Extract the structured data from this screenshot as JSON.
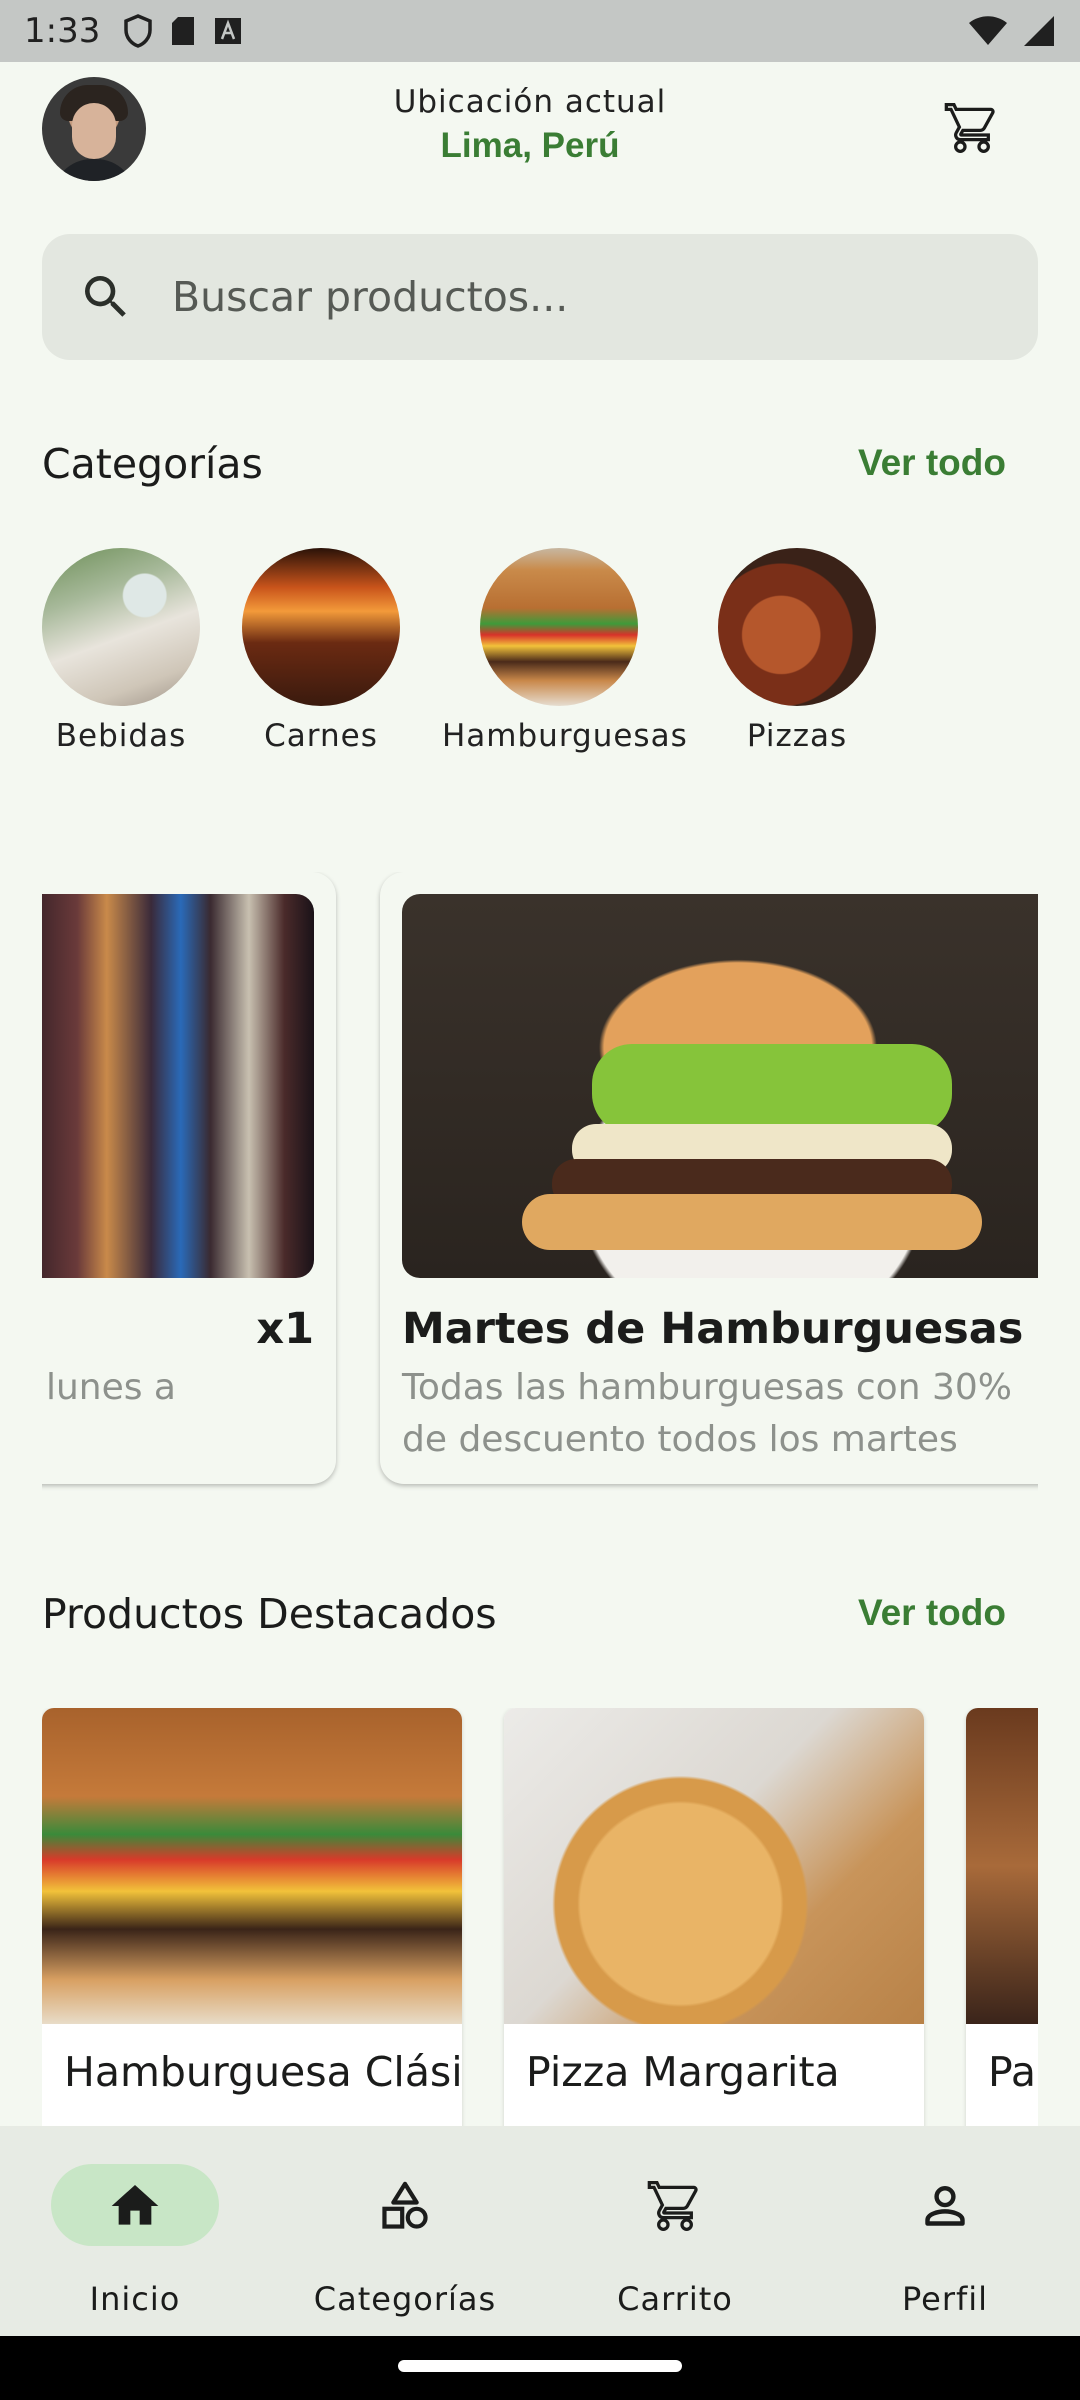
{
  "status_bar": {
    "time": "1:33"
  },
  "header": {
    "location_label": "Ubicación actual",
    "location_value": "Lima, Perú"
  },
  "search": {
    "placeholder": "Buscar productos..."
  },
  "categories": {
    "title": "Categorías",
    "see_all": "Ver todo",
    "items": [
      {
        "label": "Bebidas"
      },
      {
        "label": "Carnes"
      },
      {
        "label": "Hamburguesas"
      },
      {
        "label": "Pizzas"
      }
    ]
  },
  "promotions": [
    {
      "title": "x1",
      "description": "e lunes a"
    },
    {
      "title": "Martes de Hamburguesas",
      "description": "Todas las hamburguesas con 30% de descuento todos los martes"
    }
  ],
  "featured": {
    "title": "Productos Destacados",
    "see_all": "Ver todo",
    "items": [
      {
        "name": "Hamburguesa Clásica"
      },
      {
        "name": "Pizza Margarita"
      },
      {
        "name": "Pa"
      }
    ]
  },
  "bottom_nav": {
    "items": [
      {
        "label": "Inicio",
        "icon": "home-icon",
        "active": true
      },
      {
        "label": "Categorías",
        "icon": "categories-icon",
        "active": false
      },
      {
        "label": "Carrito",
        "icon": "cart-icon",
        "active": false
      },
      {
        "label": "Perfil",
        "icon": "person-icon",
        "active": false
      }
    ]
  },
  "colors": {
    "accent": "#3a7d34",
    "background": "#f4f8f1",
    "nav_active_pill": "#c8e6c6"
  }
}
